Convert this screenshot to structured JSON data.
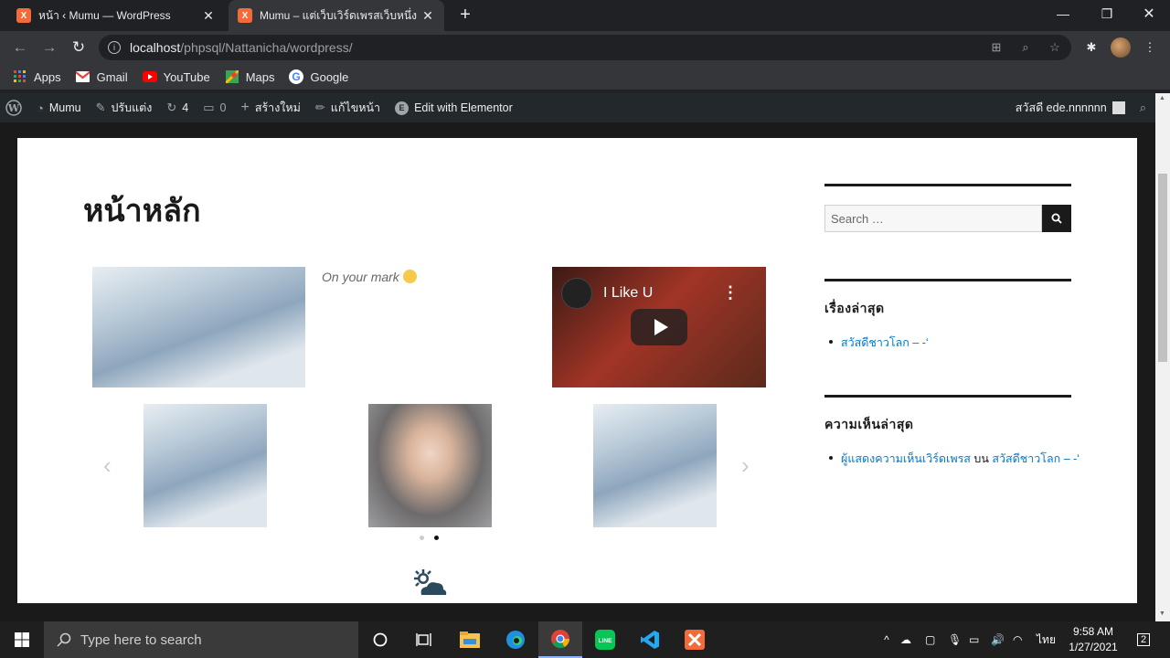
{
  "browser": {
    "tabs": [
      {
        "label": "หน้า ‹ Mumu — WordPress",
        "favicon": "X",
        "active": false
      },
      {
        "label": "Mumu – แต่เว็บเวิร์ดเพรสเว็บหนึ่ง",
        "favicon": "X",
        "active": true
      }
    ],
    "url_host": "localhost",
    "url_path": "/phpsql/Nattanicha/wordpress/",
    "bookmarks": [
      {
        "label": "Apps",
        "icon": "apps-grid-icon"
      },
      {
        "label": "Gmail",
        "icon": "gmail-icon"
      },
      {
        "label": "YouTube",
        "icon": "youtube-icon"
      },
      {
        "label": "Maps",
        "icon": "maps-icon"
      },
      {
        "label": "Google",
        "icon": "google-icon"
      }
    ]
  },
  "adminbar": {
    "site": "Mumu",
    "customize": "ปรับแต่ง",
    "updates": "4",
    "comments": "0",
    "new": "สร้างใหม่",
    "edit": "แก้ไขหน้า",
    "elementor": "Edit with Elementor",
    "greeting": "สวัสดี ede.nnnnnn"
  },
  "page": {
    "title": "หน้าหลัก",
    "caption": "On your mark",
    "video_title": "I Like U",
    "carousel_active_dot": 2
  },
  "sidebar": {
    "search_placeholder": "Search …",
    "recent_posts_title": "เรื่องล่าสุด",
    "recent_post": "สวัสดีชาวโลก – -‘",
    "recent_comments_title": "ความเห็นล่าสุด",
    "comment_author": "ผู้แสดงความเห็นเวิร์ดเพรส",
    "comment_on": "บน",
    "comment_post": "สวัสดีชาวโลก – -‘"
  },
  "taskbar": {
    "search_placeholder": "Type here to search",
    "lang": "ไทย",
    "time": "9:58 AM",
    "date": "1/27/2021",
    "notifications": "2"
  }
}
